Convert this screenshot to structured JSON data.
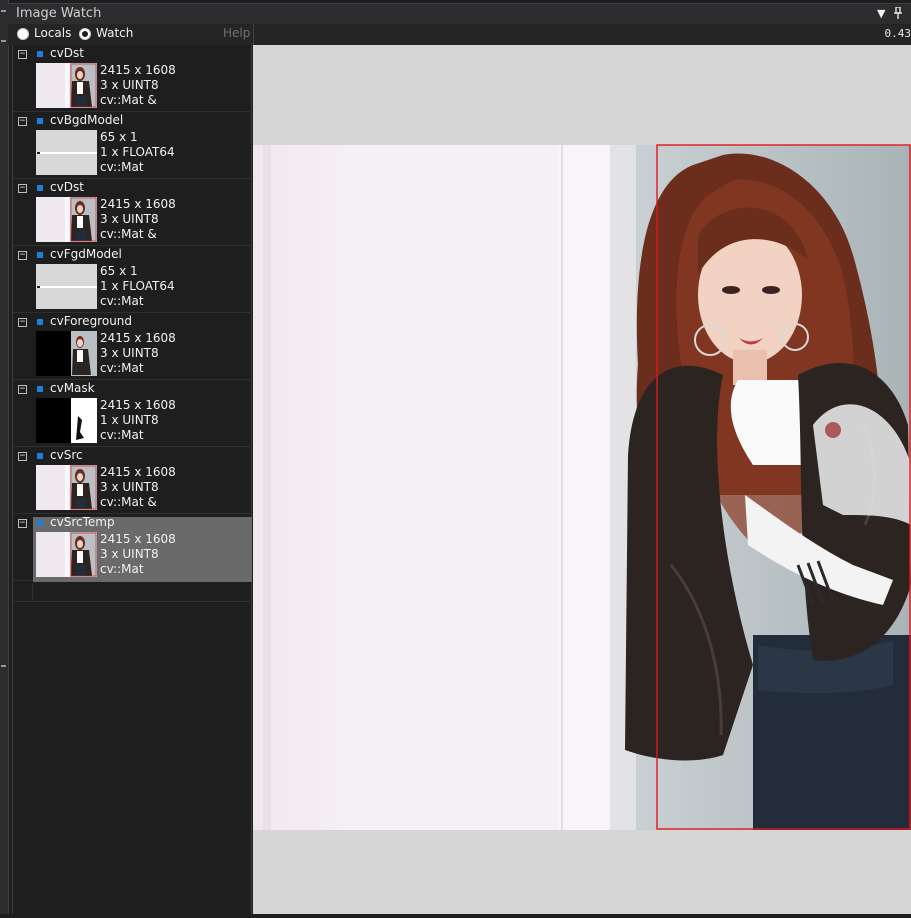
{
  "window": {
    "title": "Image Watch"
  },
  "toolbar": {
    "locals_label": "Locals",
    "watch_label": "Watch",
    "selected_mode": "Watch",
    "help_label": "Help",
    "zoom": "0.43"
  },
  "items": [
    {
      "name": "cvDst",
      "dims": "2415 x 1608",
      "format": "3 x UINT8",
      "type": "cv::Mat &",
      "thumb": "photo"
    },
    {
      "name": "cvBgdModel",
      "dims": "65 x 1",
      "format": "1 x FLOAT64",
      "type": "cv::Mat",
      "thumb": "model"
    },
    {
      "name": "cvDst",
      "dims": "2415 x 1608",
      "format": "3 x UINT8",
      "type": "cv::Mat &",
      "thumb": "photo"
    },
    {
      "name": "cvFgdModel",
      "dims": "65 x 1",
      "format": "1 x FLOAT64",
      "type": "cv::Mat",
      "thumb": "model"
    },
    {
      "name": "cvForeground",
      "dims": "2415 x 1608",
      "format": "3 x UINT8",
      "type": "cv::Mat",
      "thumb": "foreground"
    },
    {
      "name": "cvMask",
      "dims": "2415 x 1608",
      "format": "1 x UINT8",
      "type": "cv::Mat",
      "thumb": "mask"
    },
    {
      "name": "cvSrc",
      "dims": "2415 x 1608",
      "format": "3 x UINT8",
      "type": "cv::Mat &",
      "thumb": "photo"
    },
    {
      "name": "cvSrcTemp",
      "dims": "2415 x 1608",
      "format": "3 x UINT8",
      "type": "cv::Mat",
      "thumb": "photo",
      "selected": true
    }
  ],
  "colors": {
    "accent": "#1e7fd8",
    "selection_rect": "#e0181e",
    "selected_row": "#6a6a6a"
  }
}
